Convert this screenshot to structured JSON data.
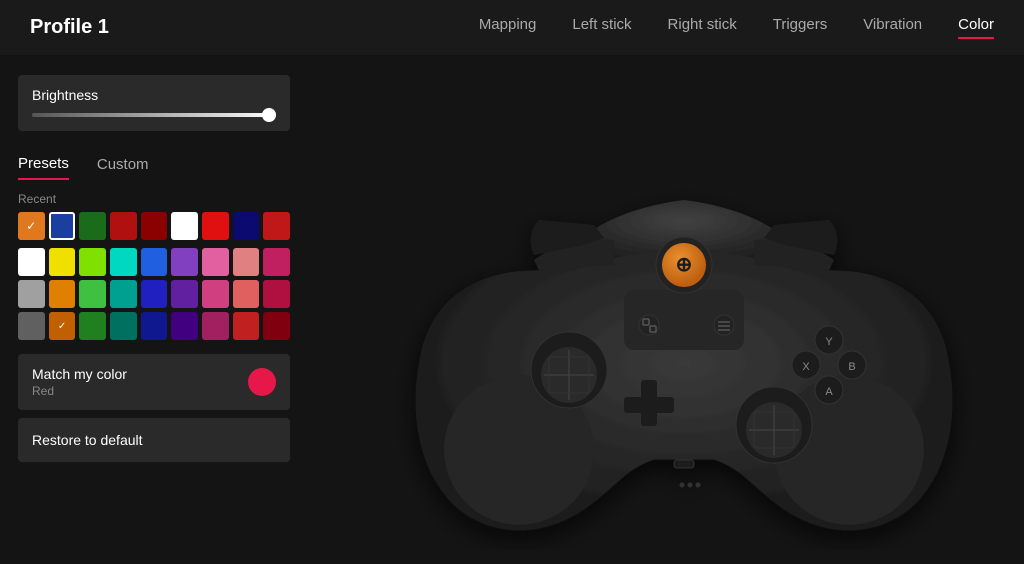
{
  "header": {
    "profile_title": "Profile 1",
    "nav": [
      {
        "label": "Mapping",
        "id": "mapping",
        "active": false
      },
      {
        "label": "Left stick",
        "id": "left-stick",
        "active": false
      },
      {
        "label": "Right stick",
        "id": "right-stick",
        "active": false
      },
      {
        "label": "Triggers",
        "id": "triggers",
        "active": false
      },
      {
        "label": "Vibration",
        "id": "vibration",
        "active": false
      },
      {
        "label": "Color",
        "id": "color",
        "active": true
      }
    ]
  },
  "left_panel": {
    "brightness_label": "Brightness",
    "tabs": [
      {
        "label": "Presets",
        "active": true
      },
      {
        "label": "Custom",
        "active": false
      }
    ],
    "recent_label": "Recent",
    "match_my_color": {
      "title": "Match my color",
      "sub_label": "Red"
    },
    "restore_label": "Restore to default"
  }
}
